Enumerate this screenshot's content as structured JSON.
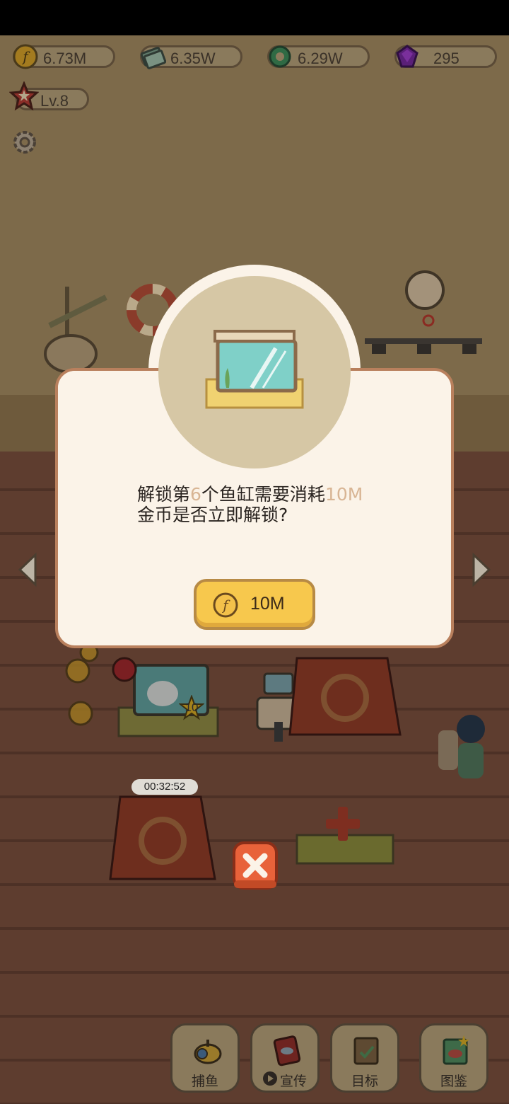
{
  "resources": {
    "coins": "6.73M",
    "cash": "6.35W",
    "gems_green": "6.29W",
    "diamonds": "295"
  },
  "level": "Lv.8",
  "dialog": {
    "message_line1_a": "解锁第",
    "message_line1_num": "6",
    "message_line1_b": "个鱼缸需要消耗",
    "message_line1_cost": "10M",
    "message_line2": "金币是否立即解锁?",
    "unlock_button_label": "10M"
  },
  "scene": {
    "timer": "00:32:52",
    "tank_star_level": "10"
  },
  "bottom_nav": [
    {
      "label": "捕鱼",
      "icon": "submarine-icon"
    },
    {
      "label": "宣传",
      "icon": "promo-card-icon"
    },
    {
      "label": "目标",
      "icon": "goal-clipboard-icon"
    },
    {
      "label": "图鉴",
      "icon": "fish-album-icon"
    }
  ],
  "colors": {
    "dialog_bg": "#fbf3e8",
    "dialog_border": "#b9805d",
    "button_yellow": "#f7c84d",
    "close_red": "#e8623a",
    "highlight_text": "#d8b594"
  }
}
